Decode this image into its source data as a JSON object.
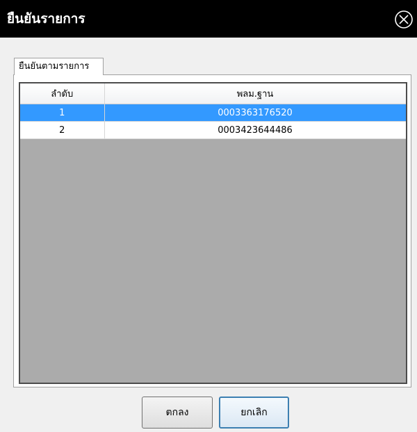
{
  "window": {
    "title": "ยืนยันรายการ",
    "close_icon": "close-circle-x-icon"
  },
  "tab": {
    "label": "ยืนยันตามรายการ"
  },
  "grid": {
    "columns": [
      "ลำดับ",
      "พลม.ฐาน"
    ],
    "rows": [
      {
        "no": "1",
        "code": "0003363176520",
        "selected": true
      },
      {
        "no": "2",
        "code": "0003423644486",
        "selected": false
      }
    ]
  },
  "buttons": {
    "ok_label": "ตกลง",
    "cancel_label": "ยกเลิก"
  },
  "colors": {
    "titlebar": "#000000",
    "selection": "#3399ff",
    "grid_empty": "#ababab",
    "focus_border": "#3c7fb1"
  }
}
